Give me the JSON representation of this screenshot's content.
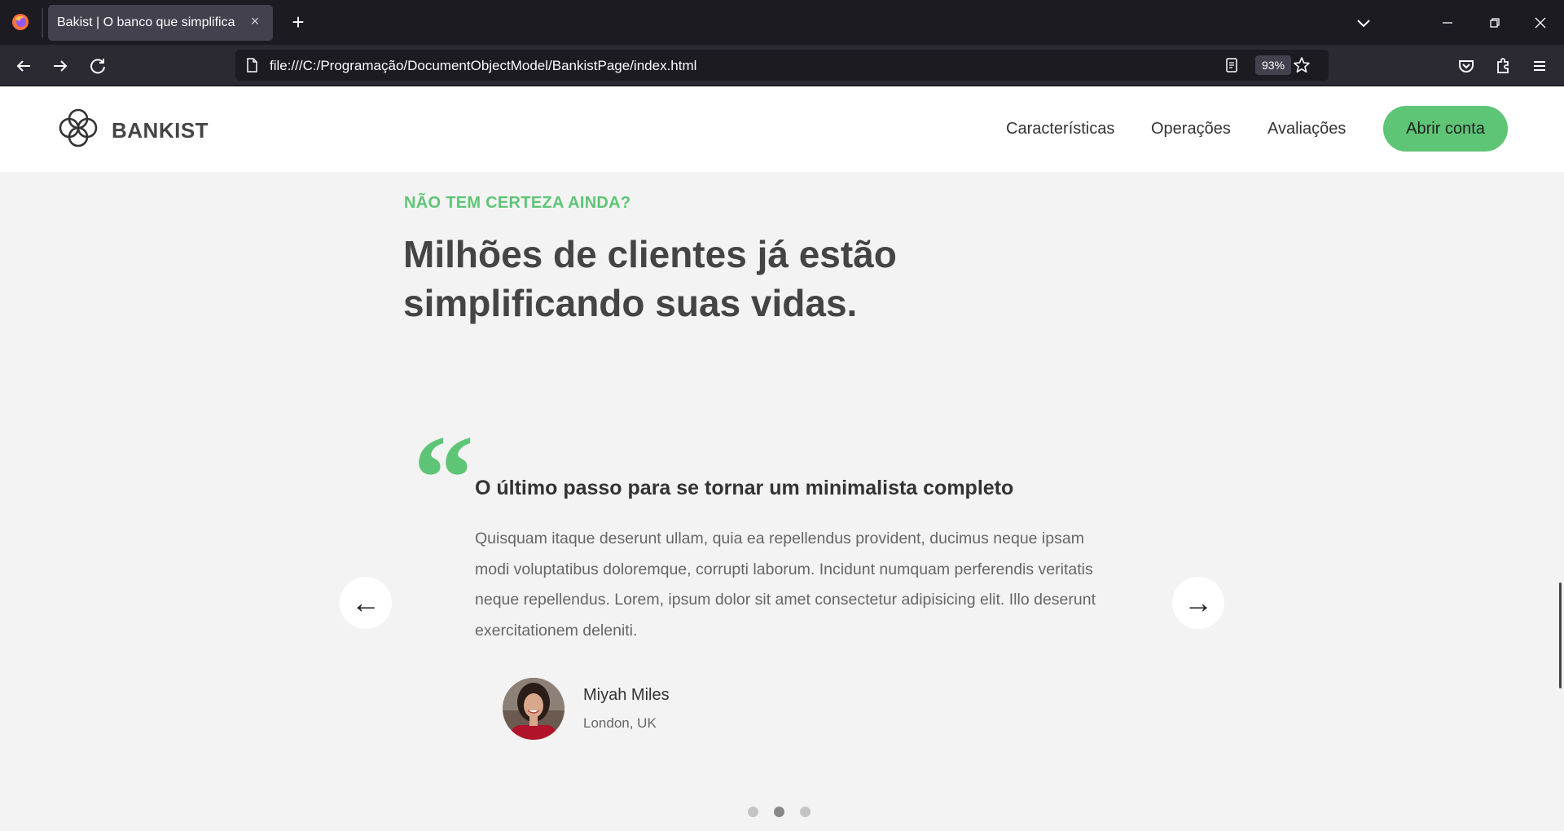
{
  "browser": {
    "tab_title": "Bakist | O banco que simplifica",
    "tab_close": "×",
    "new_tab": "+",
    "url": "file:///C:/Programação/DocumentObjectModel/BankistPage/index.html",
    "zoom": "93%"
  },
  "header": {
    "logo_text": "BANKIST",
    "nav": [
      "Características",
      "Operações",
      "Avaliações"
    ],
    "cta_label": "Abrir conta"
  },
  "section": {
    "label": "NÃO TEM CERTEZA AINDA?",
    "title": "Milhões de clientes já estão simplificando suas vidas."
  },
  "testimonial": {
    "quote_mark": "“",
    "heading": "O último passo para se tornar um minimalista completo",
    "body": "Quisquam itaque deserunt ullam, quia ea repellendus provident, ducimus neque ipsam modi voluptatibus doloremque, corrupti laborum. Incidunt numquam perferendis veritatis neque repellendus. Lorem, ipsum dolor sit amet consectetur adipisicing elit. Illo deserunt exercitationem deleniti.",
    "author_name": "Miyah Miles",
    "author_location": "London, UK"
  },
  "slider": {
    "prev_label": "←",
    "next_label": "→",
    "active_dot": 2,
    "dot_count": 3
  },
  "colors": {
    "accent": "#5ec576",
    "browser_dark": "#1c1b22",
    "page_bg": "#f3f3f3"
  }
}
